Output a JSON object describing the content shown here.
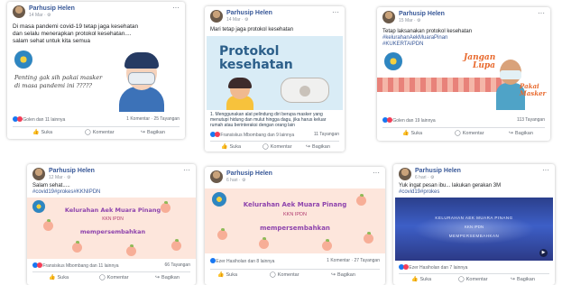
{
  "posts": [
    {
      "author": "Parhusip Helen",
      "date": "14 Mar · ⚙",
      "text_lines": [
        "Di masa pandemi covid-19 tetap jaga kesehatan",
        "dan selalu menerapkan protokol kesehatan....",
        "salam sehat untuk kita semua"
      ],
      "image_caption": "Penting gak sih pakai masker di masa pandemi ini ?????",
      "reactions": "Golen dan 11 lainnya",
      "comments_views": "1 Komentar · 25 Tayangan"
    },
    {
      "author": "Parhusip Helen",
      "date": "14 Mar · ⚙",
      "text_lines": [
        "Mari tetap jaga protokol kesehatan"
      ],
      "image_title_1": "Protokol",
      "image_title_2": "kesehatan",
      "image_caption": "1. Menggunakan alat pelindung diri berupa masker yang menutupi hidung dan mulut hingga dagu, jika harus keluar rumah atau berinteraksi dengan orang lain",
      "reactions": "Fransiskus Mbombang dan 9 lainnya",
      "comments_views": "11 Tayangan"
    },
    {
      "author": "Parhusip Helen",
      "date": "15 Mar · ⚙",
      "text_lines": [
        "Tetap laksanakan protokol kesehatan"
      ],
      "hashtags": [
        "#kelurahanAekMuaraPinan",
        "#KUKERTAIPDN"
      ],
      "image_text_1": "Jangan",
      "image_text_2": "Lupa",
      "image_text_3": "Pakai",
      "image_text_4": "Masker",
      "reactions": "Golen dan 19 lainnya",
      "comments_views": "113 Tayangan"
    },
    {
      "author": "Parhusip Helen",
      "date": "12 Mar · ⚙",
      "text_lines": [
        "Salam sehat....."
      ],
      "hashtags": [
        "#covid19#prokes#KKNIPDN"
      ],
      "image_line_1": "Kelurahan Aek Muara Pinang",
      "image_line_2": "KKN IPDN",
      "image_line_3": "mempersembahkan",
      "reactions": "Fransiskus Mbombang dan 11 lainnya",
      "comments_views": "66 Tayangan"
    },
    {
      "author": "Parhusip Helen",
      "date": "6 hari · ⚙",
      "image_line_1": "Kelurahan Aek Muara Pinang",
      "image_line_2": "KKN IPDN",
      "image_line_3": "mempersembahkan",
      "reactions": "Ezer Hasiholan dan 8 lainnya",
      "comments_views": "1 Komentar · 27 Tayangan"
    },
    {
      "author": "Parhusip Helen",
      "date": "6 hari · ⚙",
      "text_lines": [
        "Yuk ingat pesan ibu... lakukan gerakan 3M"
      ],
      "hashtags": [
        "#covid19#prokes"
      ],
      "image_line_1": "KELURAHAN AEK MUARA PINANG",
      "image_line_2": "KKN IPDN",
      "image_line_3": "MEMPERSEMBAHKAN",
      "reactions": "Ezer Hasiholan dan 7 lainnya",
      "comments_views": ""
    }
  ],
  "actions": {
    "like": "Suka",
    "comment": "Komentar",
    "share": "Bagikan"
  },
  "icons": {
    "like": "thumbs-up-icon",
    "comment": "comment-icon",
    "share": "share-icon",
    "more": "more-options-icon",
    "privacy": "privacy-icon"
  },
  "colors": {
    "author": "#385898",
    "like": "#1877f2",
    "love": "#f33e58",
    "peach_bg": "#fde6dc"
  }
}
